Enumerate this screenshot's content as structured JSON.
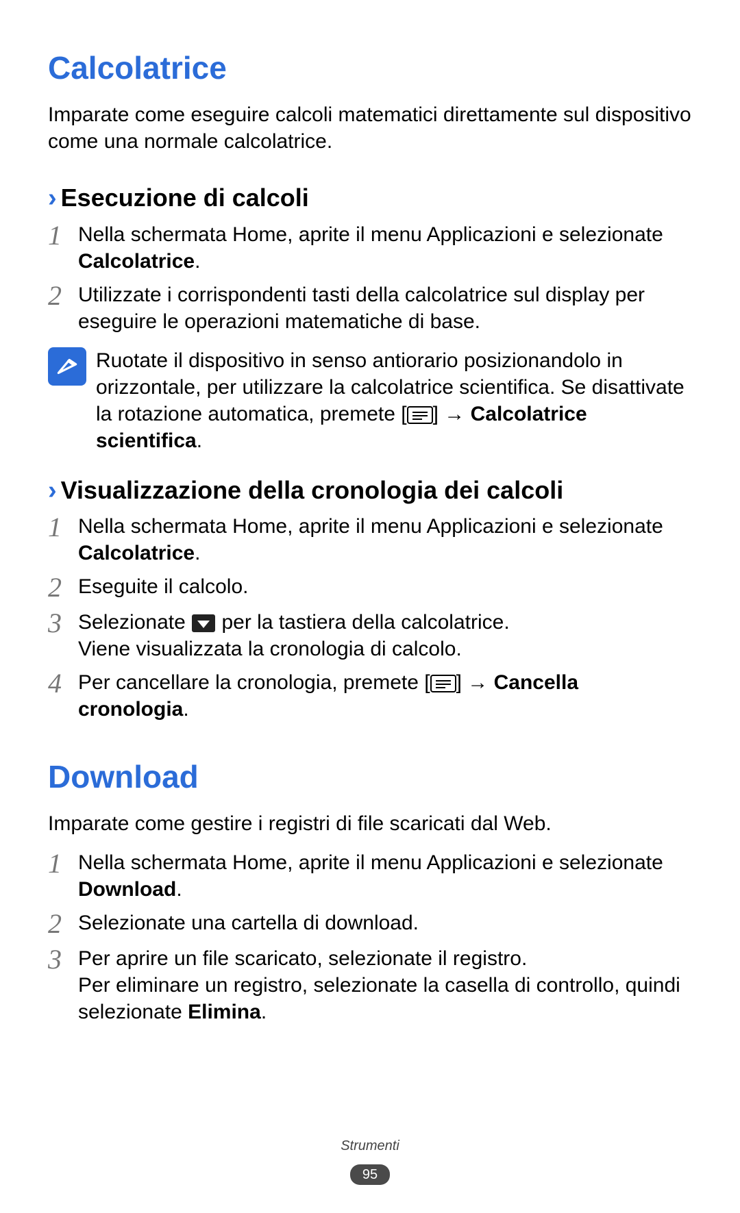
{
  "section1": {
    "title": "Calcolatrice",
    "intro": "Imparate come eseguire calcoli matematici direttamente sul dispositivo come una normale calcolatrice.",
    "sub1": {
      "title": "Esecuzione di calcoli",
      "steps": [
        {
          "num": "1",
          "pre": "Nella schermata Home, aprite il menu Applicazioni e selezionate ",
          "bold": "Calcolatrice",
          "post": "."
        },
        {
          "num": "2",
          "text": "Utilizzate i corrispondenti tasti della calcolatrice sul display per eseguire le operazioni matematiche di base."
        }
      ],
      "note": {
        "pre": "Ruotate il dispositivo in senso antiorario posizionandolo in orizzontale, per utilizzare la calcolatrice scientifica. Se disattivate la rotazione automatica, premete [",
        "arrow": "] → ",
        "bold": "Calcolatrice scientifica",
        "post": "."
      }
    },
    "sub2": {
      "title": "Visualizzazione della cronologia dei calcoli",
      "step1": {
        "num": "1",
        "pre": "Nella schermata Home, aprite il menu Applicazioni e selezionate ",
        "bold": "Calcolatrice",
        "post": "."
      },
      "step2": {
        "num": "2",
        "text": "Eseguite il calcolo."
      },
      "step3": {
        "num": "3",
        "pre": "Selezionate ",
        "mid": " per la tastiera della calcolatrice.",
        "line2": "Viene visualizzata la cronologia di calcolo."
      },
      "step4": {
        "num": "4",
        "pre": "Per cancellare la cronologia, premete [",
        "arrow": "] → ",
        "bold": "Cancella cronologia",
        "post": "."
      }
    }
  },
  "section2": {
    "title": "Download",
    "intro": "Imparate come gestire i registri di file scaricati dal Web.",
    "step1": {
      "num": "1",
      "pre": "Nella schermata Home, aprite il menu Applicazioni e selezionate ",
      "bold": "Download",
      "post": "."
    },
    "step2": {
      "num": "2",
      "text": "Selezionate una cartella di download."
    },
    "step3": {
      "num": "3",
      "line1": "Per aprire un file scaricato, selezionate il registro.",
      "line2pre": "Per eliminare un registro, selezionate la casella di controllo, quindi selezionate ",
      "bold": "Elimina",
      "post": "."
    }
  },
  "footer": {
    "category": "Strumenti",
    "page": "95"
  }
}
